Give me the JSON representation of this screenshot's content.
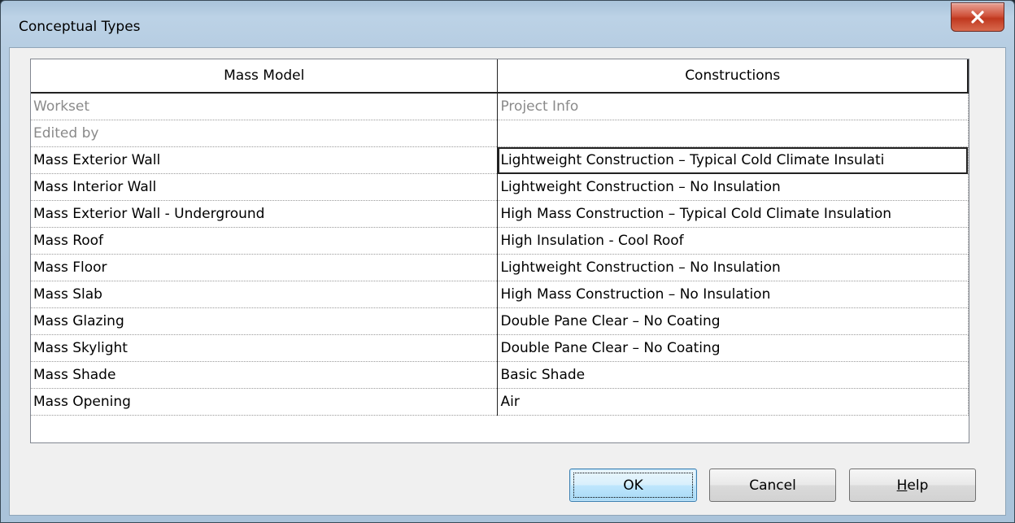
{
  "window": {
    "title": "Conceptual Types",
    "close_icon": "close-icon"
  },
  "grid": {
    "columns": [
      "Mass Model",
      "Constructions"
    ],
    "readonly_rows": [
      [
        "Workset",
        "Project Info"
      ],
      [
        "Edited by",
        ""
      ]
    ],
    "rows": [
      [
        "Mass Exterior Wall",
        "Lightweight Construction – Typical Cold Climate Insulati"
      ],
      [
        "Mass Interior Wall",
        "Lightweight Construction – No Insulation"
      ],
      [
        "Mass Exterior Wall - Underground",
        "High Mass Construction – Typical Cold Climate Insulation"
      ],
      [
        "Mass Roof",
        "High Insulation - Cool Roof"
      ],
      [
        "Mass Floor",
        "Lightweight Construction – No Insulation"
      ],
      [
        "Mass Slab",
        "High Mass Construction – No Insulation"
      ],
      [
        "Mass Glazing",
        "Double Pane Clear – No Coating"
      ],
      [
        "Mass Skylight",
        "Double Pane Clear – No Coating"
      ],
      [
        "Mass Shade",
        "Basic Shade"
      ],
      [
        "Mass Opening",
        "Air"
      ]
    ]
  },
  "buttons": {
    "ok": "OK",
    "cancel": "Cancel",
    "help_mnemonic": "H",
    "help_rest": "elp"
  },
  "colors": {
    "close_button": "#c7432a",
    "readonly_text": "#8a8a8a"
  }
}
